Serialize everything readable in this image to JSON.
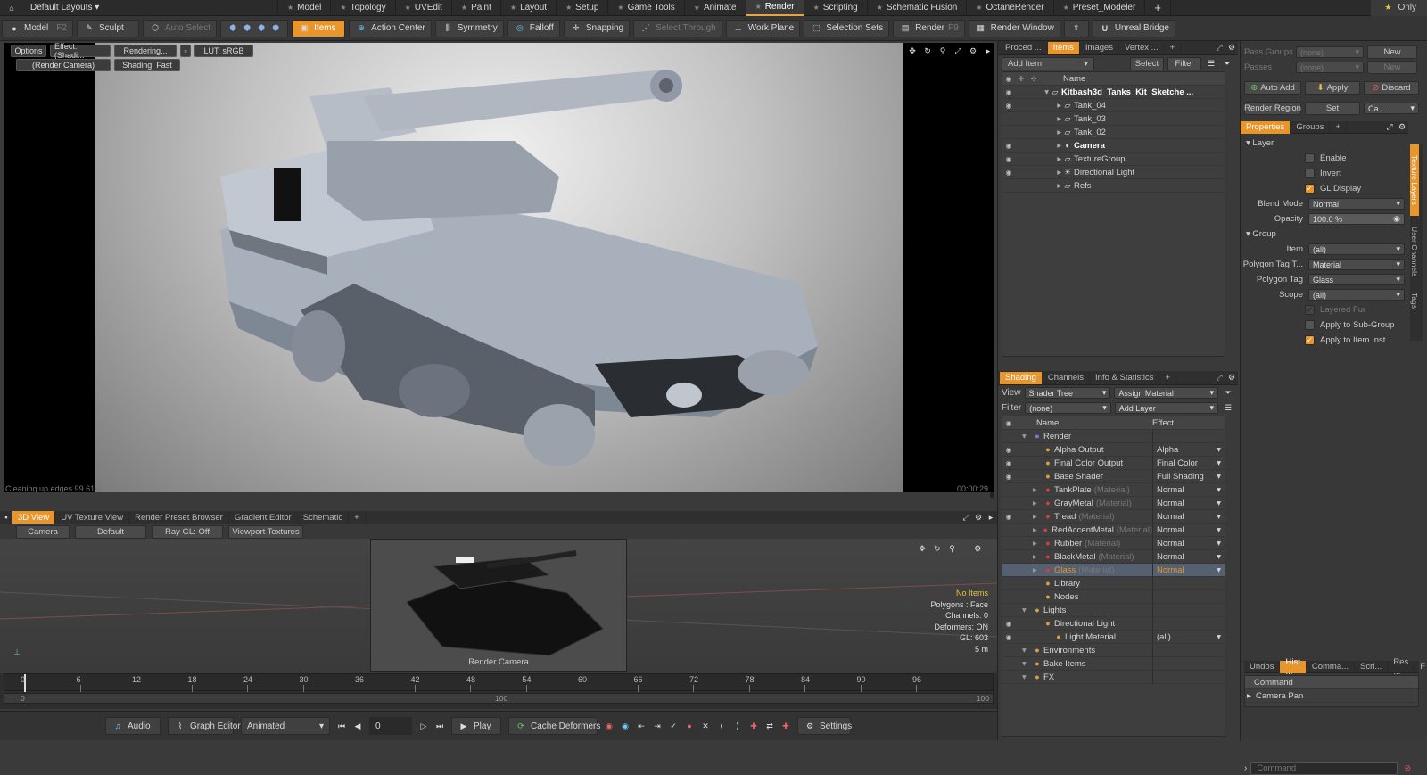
{
  "topbar": {
    "layout_menu": "Default Layouts ▾",
    "tabs": [
      "Model",
      "Topology",
      "UVEdit",
      "Paint",
      "Layout",
      "Setup",
      "Game Tools",
      "Animate",
      "Render",
      "Scripting",
      "Schematic Fusion",
      "OctaneRender",
      "Preset_Modeler"
    ],
    "active_tab": "Render",
    "only_label": "Only"
  },
  "toolbar": {
    "model": "Model",
    "model_key": "F2",
    "sculpt": "Sculpt",
    "auto_select": "Auto Select",
    "items": "Items",
    "action_center": "Action Center",
    "symmetry": "Symmetry",
    "falloff": "Falloff",
    "snapping": "Snapping",
    "select_through": "Select Through",
    "work_plane": "Work Plane",
    "selection_sets": "Selection Sets",
    "render": "Render",
    "render_key": "F9",
    "render_window": "Render Window",
    "unreal_bridge": "Unreal Bridge"
  },
  "viewport": {
    "options": "Options",
    "effect": "Effect: (Shadi...",
    "rendering": "Rendering...",
    "lut": "LUT: sRGB",
    "camera": "(Render Camera)",
    "shading": "Shading: Fast",
    "status": "Cleaning up edges 99.61%",
    "time": "00:00:29"
  },
  "lower_panel": {
    "tabs": [
      "3D View",
      "UV Texture View",
      "Render Preset Browser",
      "Gradient Editor",
      "Schematic"
    ],
    "active_tab": "3D View",
    "camera_btn": "Camera",
    "default_btn": "Default",
    "raygl_btn": "Ray GL: Off",
    "viewport_textures": "Viewport Textures",
    "cam_label": "Render Camera",
    "info": [
      "No Items",
      "Polygons : Face",
      "Channels: 0",
      "Deformers: ON",
      "GL: 603",
      "5 m"
    ]
  },
  "timeline": {
    "ticks": [
      "0",
      "6",
      "12",
      "18",
      "24",
      "30",
      "36",
      "42",
      "48",
      "54",
      "60",
      "66",
      "72",
      "78",
      "84",
      "90",
      "96"
    ],
    "sub_start": "0",
    "sub_mid": "100",
    "sub_end": "100"
  },
  "bottombar": {
    "audio": "Audio",
    "graph_editor": "Graph Editor",
    "animated": "Animated",
    "frame": "0",
    "play": "Play",
    "cache_deformers": "Cache Deformers",
    "settings": "Settings"
  },
  "items_panel": {
    "tabs": [
      "Proced ...",
      "Items",
      "Images",
      "Vertex ..."
    ],
    "active_tab": "Items",
    "add_item": "Add Item",
    "select": "Select",
    "filter": "Filter",
    "name_col": "Name",
    "rows": [
      {
        "label": "Kitbash3d_Tanks_Kit_Sketche ...",
        "depth": 0,
        "eye": true,
        "bold": true
      },
      {
        "label": "Tank_04",
        "depth": 1,
        "eye": true,
        "bold": false
      },
      {
        "label": "Tank_03",
        "depth": 1,
        "eye": false,
        "bold": false
      },
      {
        "label": "Tank_02",
        "depth": 1,
        "eye": false,
        "bold": false
      },
      {
        "label": "Camera",
        "depth": 1,
        "eye": true,
        "bold": true
      },
      {
        "label": "TextureGroup",
        "depth": 1,
        "eye": true,
        "bold": false
      },
      {
        "label": "Directional Light",
        "depth": 1,
        "eye": true,
        "bold": false
      },
      {
        "label": "Refs",
        "depth": 1,
        "eye": false,
        "bold": false
      }
    ]
  },
  "shading_panel": {
    "tabs": [
      "Shading",
      "Channels",
      "Info & Statistics"
    ],
    "active_tab": "Shading",
    "view_label": "View",
    "view_value": "Shader Tree",
    "assign_material": "Assign Material",
    "filter_label": "Filter",
    "filter_value": "(none)",
    "add_layer": "Add Layer",
    "name_col": "Name",
    "effect_col": "Effect",
    "rows": [
      {
        "name": "Render",
        "mat": "",
        "effect": "",
        "depth": 0,
        "eye": false
      },
      {
        "name": "Alpha Output",
        "mat": "",
        "effect": "Alpha",
        "depth": 1,
        "eye": true
      },
      {
        "name": "Final Color Output",
        "mat": "",
        "effect": "Final Color",
        "depth": 1,
        "eye": true
      },
      {
        "name": "Base Shader",
        "mat": "",
        "effect": "Full Shading",
        "depth": 1,
        "eye": true
      },
      {
        "name": "TankPlate",
        "mat": "(Material)",
        "effect": "Normal",
        "depth": 1,
        "eye": false
      },
      {
        "name": "GrayMetal",
        "mat": "(Material)",
        "effect": "Normal",
        "depth": 1,
        "eye": false
      },
      {
        "name": "Tread",
        "mat": "(Material)",
        "effect": "Normal",
        "depth": 1,
        "eye": true
      },
      {
        "name": "RedAccentMetal",
        "mat": "(Material)",
        "effect": "Normal",
        "depth": 1,
        "eye": false
      },
      {
        "name": "Rubber",
        "mat": "(Material)",
        "effect": "Normal",
        "depth": 1,
        "eye": false
      },
      {
        "name": "BlackMetal",
        "mat": "(Material)",
        "effect": "Normal",
        "depth": 1,
        "eye": false
      },
      {
        "name": "Glass",
        "mat": "(Material)",
        "effect": "Normal",
        "depth": 1,
        "eye": false
      },
      {
        "name": "Library",
        "mat": "",
        "effect": "",
        "depth": 1,
        "eye": false
      },
      {
        "name": "Nodes",
        "mat": "",
        "effect": "",
        "depth": 1,
        "eye": false
      },
      {
        "name": "Lights",
        "mat": "",
        "effect": "",
        "depth": 0,
        "eye": false
      },
      {
        "name": "Directional Light",
        "mat": "",
        "effect": "",
        "depth": 1,
        "eye": true
      },
      {
        "name": "Light Material",
        "mat": "",
        "effect": "(all)",
        "depth": 2,
        "eye": true
      },
      {
        "name": "Environments",
        "mat": "",
        "effect": "",
        "depth": 0,
        "eye": false
      },
      {
        "name": "Bake Items",
        "mat": "",
        "effect": "",
        "depth": 0,
        "eye": false
      },
      {
        "name": "FX",
        "mat": "",
        "effect": "",
        "depth": 0,
        "eye": false
      }
    ],
    "selected": "Glass"
  },
  "properties_panel": {
    "pass_groups": "Pass Groups",
    "pass_groups_val": "(none)",
    "new": "New",
    "passes": "Passes",
    "passes_val": "(none)",
    "new2": "New",
    "auto_add": "Auto Add",
    "apply": "Apply",
    "discard": "Discard",
    "render_region": "Render Region",
    "set": "Set",
    "ca": "Ca ...",
    "tabs": [
      "Properties",
      "Groups"
    ],
    "active_tab": "Properties",
    "layer_header": "Layer",
    "enable": "Enable",
    "invert": "Invert",
    "gl_display": "GL Display",
    "blend_mode": "Blend Mode",
    "blend_mode_val": "Normal",
    "opacity": "Opacity",
    "opacity_val": "100.0 %",
    "group_header": "Group",
    "item": "Item",
    "item_val": "(all)",
    "poly_tag_type": "Polygon Tag T...",
    "poly_tag_type_val": "Material",
    "poly_tag": "Polygon Tag",
    "poly_tag_val": "Glass",
    "scope": "Scope",
    "scope_val": "(all)",
    "layered_fur": "Layered Fur",
    "apply_sub": "Apply to Sub-Group",
    "apply_item": "Apply to Item Inst...",
    "side_tabs": [
      "Texture Layers",
      "User Channels",
      "Tags"
    ],
    "bottom_tabs": [
      "Undos",
      "Hist ...",
      "Comma...",
      "Scri...",
      "Res ...",
      "F"
    ],
    "bottom_active": "Hist ...",
    "command_header": "Command",
    "camera_pan": "Camera Pan",
    "command_placeholder": "Command"
  },
  "colors": {
    "accent": "#e8952c",
    "selected_row": "#556070"
  }
}
